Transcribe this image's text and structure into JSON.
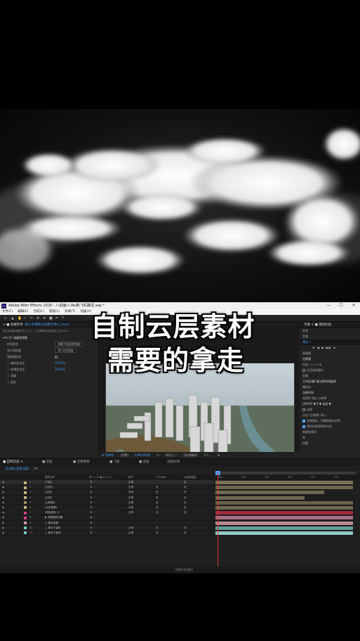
{
  "overlay": {
    "line1": "自制云层素材",
    "line2": "需要的拿走"
  },
  "window": {
    "title": "Adobe After Effects 2020 - 八桌面\\八Ae课\\飞机路径.aep *",
    "logo": "Ae"
  },
  "menu": [
    "文件(F)",
    "编辑(E)",
    "合成(C)",
    "图层(L)",
    "效果(T)",
    "动画(A)"
  ],
  "project_panel": {
    "tab": "× ■ 效果控件",
    "tab_highlight": "(拿工车管所与指景文件L.J.mov)",
    "subtitle": "西区总域量设置文件工.(L.)-- 八光基准化电路文件上自.mov",
    "effect_name": "CC 海量挡频数",
    "rows": [
      {
        "label": "时间类型",
        "value": "地图平面投影角度",
        "style": "ddl"
      },
      {
        "label": "显示相机值",
        "value": "3D 计划渲染",
        "style": "ddl"
      },
      {
        "label": "强制相机场",
        "value": "",
        "style": "checkbox"
      },
      {
        "label": "ⓘ 轴向变光比",
        "value": "100.0%",
        "style": "blue"
      },
      {
        "label": "ⓘ 前景变光比",
        "value": "100.0%",
        "style": "blue"
      },
      {
        "label": "ⓘ 高级",
        "value": "",
        "style": "plain"
      }
    ],
    "footer": "> 渲染"
  },
  "comp_panel": {
    "tab": "× ■ 合成 飞机合成",
    "controls": [
      "⊕ 22962",
      "(完整)",
      "0:00:00:00",
      "⊡",
      "四分之一",
      "活动摄像机",
      "1个...",
      "⊞"
    ]
  },
  "right_panel": {
    "top_tabs": [
      "字幕",
      "✕",
      "■ 键盘附加"
    ],
    "sections": [
      {
        "text": "信息",
        "style": "plain"
      },
      {
        "text": "音频",
        "style": "plain"
      },
      {
        "text": "预览 ≡",
        "style": "sel"
      },
      {
        "text": "⏮ ◀ ▶ ▶▶ ⏭",
        "style": "btns"
      },
      {
        "text": "快捷键",
        "style": "plain"
      },
      {
        "text": "空格键",
        "style": "b"
      },
      {
        "text": "包含: ◁ ◇ ⊡ ⊞",
        "style": "plain"
      },
      {
        "text": "在回放前缓存",
        "style": "check-off"
      },
      {
        "text": "范围",
        "style": "plain"
      },
      {
        "text": "工作区域扩展当前时间延伸",
        "style": "b"
      },
      {
        "text": "播放自",
        "style": "plain"
      },
      {
        "text": "当前时间",
        "style": "b"
      },
      {
        "text": "帧速率    跳过    分辨率",
        "style": "plain"
      },
      {
        "text": "(29.97) ▼  0 ▼  自动 ▼",
        "style": "b"
      },
      {
        "text": "全屏",
        "style": "check-off"
      },
      {
        "text": "点击 (空格键) 停止:",
        "style": "plain"
      },
      {
        "text": "如果缓存，则播放缓存的帧",
        "style": "check-on"
      },
      {
        "text": "将时间移到预览时间",
        "style": "check-on"
      },
      {
        "text": "效果和预设",
        "style": "plain"
      },
      {
        "text": "库",
        "style": "plain"
      },
      {
        "text": "段落",
        "style": "plain"
      }
    ]
  },
  "timeline": {
    "tabs": [
      "■ 自制云层 ≡",
      "■ 云层",
      "■ 全景视图",
      "■ 飞机",
      "■ 云层",
      "渲染队列"
    ],
    "timecode": "0:00:00:00",
    "search_placeholder": "ρ▾",
    "columns": {
      "layer_name": "图层名称",
      "switches": "单 ✳ \\ fx ▣ ⊘ ◯ ⊛",
      "mode": "模式",
      "trkmat": "T TrkMat",
      "parent": "父级和链接"
    },
    "ruler_ticks": [
      "00s",
      "05s",
      "10s",
      "15s",
      "20s",
      "25s"
    ],
    "layers": [
      {
        "num": "1",
        "name": "[飞机]",
        "color": "#c8b27a",
        "mode": "正常",
        "trkmat": "",
        "parent": "无"
      },
      {
        "num": "2",
        "name": "[云层1]",
        "color": "#c8b27a",
        "mode": "正常",
        "trkmat": "无",
        "parent": "无"
      },
      {
        "num": "3",
        "name": "[云层]",
        "color": "#c8b27a",
        "mode": "正常",
        "trkmat": "无",
        "parent": "无"
      },
      {
        "num": "4",
        "name": "[云层]",
        "color": "#c8b27a",
        "mode": "正常",
        "trkmat": "无",
        "parent": "无"
      },
      {
        "num": "5",
        "name": "云层调色",
        "color": "#a08a64",
        "mode": "正常",
        "trkmat": "无",
        "parent": "无"
      },
      {
        "num": "6",
        "name": "[云层遮罩]",
        "color": "#c8b27a",
        "mode": "正常",
        "trkmat": "无",
        "parent": "无"
      },
      {
        "num": "7",
        "name": "[测量调色 1]",
        "color": "#d0418a",
        "mode": "正常",
        "trkmat": "无",
        "parent": "无"
      },
      {
        "num": "8",
        "name": "▶ 调整图层设置",
        "color": "#d0418a",
        "mode": "",
        "trkmat": "",
        "parent": ""
      },
      {
        "num": "9",
        "name": "□ 图标背景",
        "color": "#d59aa6",
        "mode": "",
        "trkmat": "",
        "parent": ""
      },
      {
        "num": "10",
        "name": "□ 景位于装饰",
        "color": "#76c3bd",
        "mode": "正常",
        "trkmat": "无",
        "parent": "无"
      },
      {
        "num": "11",
        "name": "□ 景位于装饰",
        "color": "#76c3bd",
        "mode": "正常",
        "trkmat": "无",
        "parent": "无"
      }
    ],
    "bars": [
      {
        "color": "#7a7259",
        "start": 0.0,
        "end": 1.0
      },
      {
        "color": "#6e684f",
        "start": 0.0,
        "end": 1.0
      },
      {
        "color": "#6e684f",
        "start": 0.0,
        "end": 0.79
      },
      {
        "color": "#6e684f",
        "start": 0.0,
        "end": 0.65
      },
      {
        "color": "#66604a",
        "start": 0.0,
        "end": 1.0
      },
      {
        "color": "#6e684f",
        "start": 0.0,
        "end": 1.0
      },
      {
        "color": "#a02a3a",
        "start": 0.0,
        "end": 1.0
      },
      {
        "color": "#a76f84",
        "start": 0.0,
        "end": 1.0
      },
      {
        "color": "#b58a95",
        "start": 0.0,
        "end": 1.0
      },
      {
        "color": "#5f9c97",
        "start": 0.0,
        "end": 1.0
      },
      {
        "color": "#8ec8c3",
        "start": 0.0,
        "end": 1.0
      }
    ],
    "footer": "切换开关/模式"
  }
}
